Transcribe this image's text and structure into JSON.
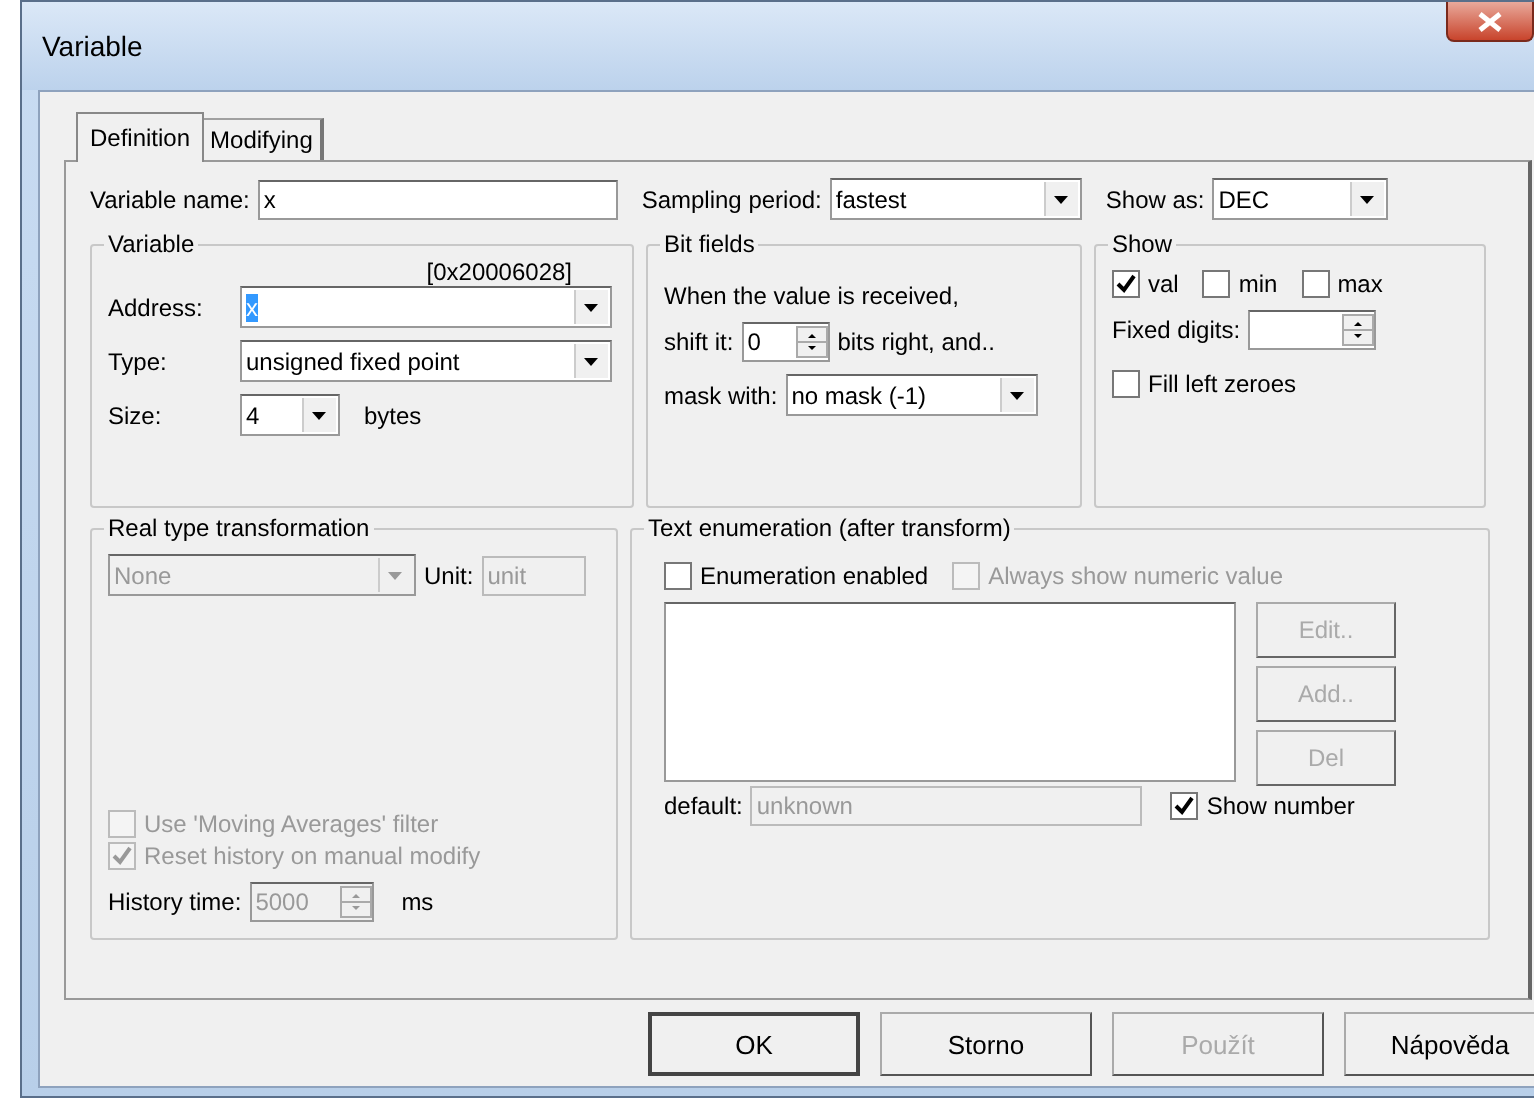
{
  "window": {
    "title": "Variable"
  },
  "tabs": [
    {
      "label": "Definition",
      "selected": true
    },
    {
      "label": "Modifying",
      "selected": false
    }
  ],
  "top_row": {
    "variable_name": {
      "label": "Variable name:",
      "value": "x"
    },
    "sampling_period": {
      "label": "Sampling period:",
      "value": "fastest"
    },
    "show_as": {
      "label": "Show as:",
      "value": "DEC"
    }
  },
  "variable_group": {
    "title": "Variable",
    "address_hint": "[0x20006028]",
    "address": {
      "label": "Address:",
      "value": "x",
      "highlighted": true
    },
    "type": {
      "label": "Type:",
      "value": "unsigned fixed point"
    },
    "size": {
      "label": "Size:",
      "value": "4",
      "unit": "bytes"
    }
  },
  "bit_fields": {
    "title": "Bit fields",
    "note": "When the value is received,",
    "shift": {
      "label": "shift it:",
      "value": "0",
      "suffix": "bits right, and.."
    },
    "mask": {
      "label": "mask with:",
      "value": "no mask (-1)"
    }
  },
  "show": {
    "title": "Show",
    "checks": [
      {
        "label": "val",
        "checked": true
      },
      {
        "label": "min",
        "checked": false
      },
      {
        "label": "max",
        "checked": false
      }
    ],
    "fixed_digits": {
      "label": "Fixed digits:"
    },
    "fill_left_zeroes": {
      "label": "Fill left zeroes",
      "checked": false
    }
  },
  "real_type": {
    "title": "Real type transformation",
    "transform": {
      "value": "None",
      "disabled": true
    },
    "unit": {
      "label": "Unit:",
      "value": "unit",
      "disabled": true
    },
    "options": [
      {
        "label": "Use 'Moving Averages' filter",
        "checked": false,
        "disabled": true
      },
      {
        "label": "Reset history on manual modify",
        "checked": true,
        "disabled": true
      }
    ],
    "history_time": {
      "label": "History time:",
      "value": "5000",
      "unit": "ms",
      "disabled": true
    }
  },
  "text_enumeration": {
    "title": "Text enumeration (after transform)",
    "options": [
      {
        "label": "Enumeration enabled",
        "checked": false,
        "disabled": false
      },
      {
        "label": "Always show numeric value",
        "checked": false,
        "disabled": true
      }
    ],
    "buttons": [
      {
        "label": "Edit..",
        "disabled": true
      },
      {
        "label": "Add..",
        "disabled": true
      },
      {
        "label": "Del",
        "disabled": true
      }
    ],
    "default": {
      "label": "default:",
      "value": "unknown",
      "disabled": true
    },
    "show_number": {
      "label": "Show number",
      "checked": true,
      "disabled": false
    }
  },
  "buttons": [
    {
      "label": "OK",
      "disabled": false,
      "default": true
    },
    {
      "label": "Storno",
      "disabled": false,
      "default": false
    },
    {
      "label": "Použít",
      "disabled": true,
      "default": false
    },
    {
      "label": "Nápověda",
      "disabled": false,
      "default": false
    }
  ]
}
